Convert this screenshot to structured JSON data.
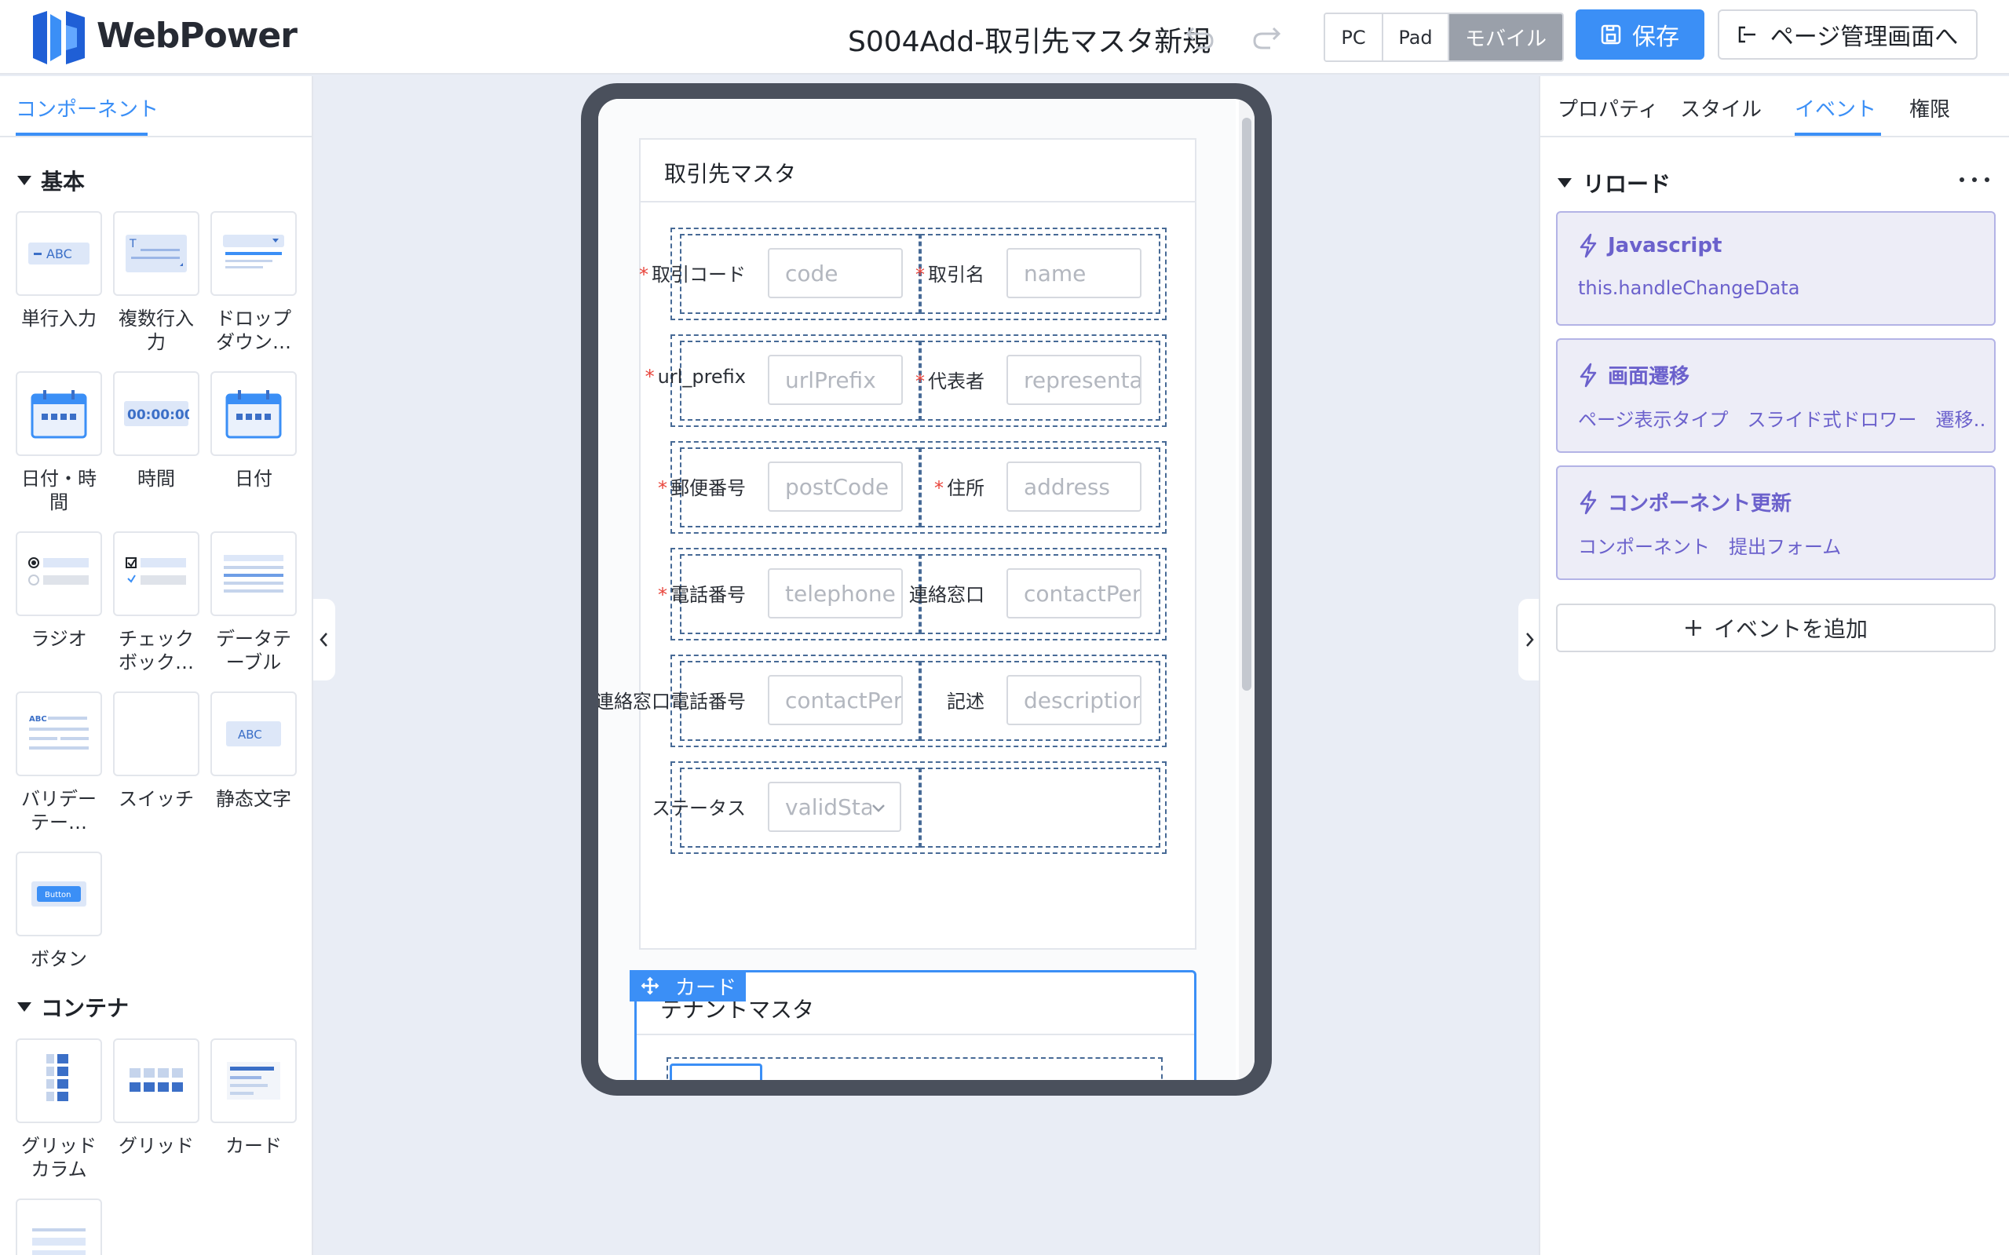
{
  "header": {
    "brand": "WebPower",
    "page_title": "S004Add-取引先マスタ新規",
    "devices": {
      "pc": "PC",
      "pad": "Pad",
      "mobile": "モバイル",
      "selected": "モバイル"
    },
    "save_label": "保存",
    "page_mgmt_label": "ページ管理画面へ"
  },
  "left_panel": {
    "tab": "コンポーネント",
    "sections": {
      "basic": "基本",
      "container": "コンテナ"
    },
    "basic_items": [
      "単行入力",
      "複数行入力",
      "ドロップダウン…",
      "日付・時間",
      "時間",
      "日付",
      "ラジオ",
      "チェックボック…",
      "データテーブル",
      "バリデーテー…",
      "スイッチ",
      "静态文字",
      "ボタン"
    ],
    "container_items": [
      "グリッドカラム",
      "グリッド",
      "カード"
    ],
    "tile_text": {
      "abc": "ABC",
      "time": "00:00:00",
      "button": "Button"
    }
  },
  "canvas": {
    "card1": {
      "title": "取引先マスタ",
      "rows": [
        {
          "left_label": "取引コード",
          "left_required": true,
          "left_placeholder": "code",
          "right_label": "取引名",
          "right_required": true,
          "right_placeholder": "name"
        },
        {
          "left_label": "url_prefix",
          "left_required": true,
          "left_placeholder": "urlPrefix",
          "right_label": "代表者",
          "right_required": true,
          "right_placeholder": "representative"
        },
        {
          "left_label": "郵便番号",
          "left_required": true,
          "left_placeholder": "postCode",
          "right_label": "住所",
          "right_required": true,
          "right_placeholder": "address"
        },
        {
          "left_label": "電話番号",
          "left_required": true,
          "left_placeholder": "telephone",
          "right_label": "連絡窓口",
          "right_required": false,
          "right_placeholder": "contactPerson"
        },
        {
          "left_label": "連絡窓口電話番号",
          "left_required": false,
          "left_placeholder": "contactPersonTel",
          "right_label": "記述",
          "right_required": false,
          "right_placeholder": "description"
        },
        {
          "left_label": "ステータス",
          "left_required": false,
          "left_placeholder": "validStatus",
          "right_label": "",
          "right_required": false,
          "right_placeholder": ""
        }
      ]
    },
    "card2": {
      "tag": "カード",
      "title": "テナントマスタ"
    }
  },
  "right_panel": {
    "tabs": [
      "プロパティ",
      "スタイル",
      "イベント",
      "権限"
    ],
    "active_tab": "イベント",
    "section": "リロード",
    "events": [
      {
        "title": "Javascript",
        "detail": "this.handleChangeData"
      },
      {
        "title": "画面遷移",
        "detail": "ページ表示タイプ　スライド式ドロワー　遷移…"
      },
      {
        "title": "コンポーネント更新",
        "detail": "コンポーネント　提出フォーム"
      }
    ],
    "add_event_label": "イベントを追加"
  },
  "colors": {
    "accent": "#3b8ff6",
    "event_purple": "#6b61cc",
    "event_bg": "#ededf7",
    "required": "#e8453c",
    "dashed_outline": "#476a96"
  },
  "icons": [
    "logo-icon",
    "undo-icon",
    "redo-icon",
    "save-icon",
    "exit-icon",
    "caret-down-icon",
    "chevron-left-icon",
    "chevron-right-icon",
    "move-icon",
    "bolt-icon",
    "more-icon",
    "plus-icon",
    "select-chevron-icon"
  ]
}
